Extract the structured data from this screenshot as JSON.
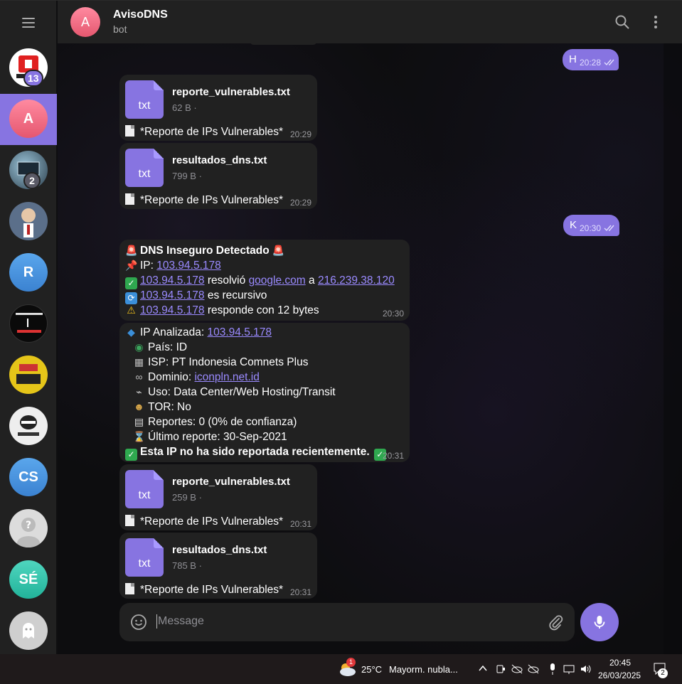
{
  "sidebar": {
    "items": [
      {
        "initials": "",
        "badge": "13",
        "color": "#ffffff"
      },
      {
        "initials": "A",
        "badge": "",
        "color": "#8774e1",
        "active": true
      },
      {
        "initials": "",
        "badge": "2",
        "color": "#4a6a7a"
      },
      {
        "initials": "",
        "badge": "",
        "color": "#5b6f8a"
      },
      {
        "initials": "R",
        "badge": "",
        "color": "#4a90d9"
      },
      {
        "initials": "",
        "badge": "",
        "color": "#111111"
      },
      {
        "initials": "",
        "badge": "",
        "color": "#e2c21d"
      },
      {
        "initials": "",
        "badge": "",
        "color": "#e8e8e8"
      },
      {
        "initials": "CS",
        "badge": "",
        "color": "#3b88d6"
      },
      {
        "initials": "",
        "badge": "",
        "color": "#d9d9d9"
      },
      {
        "initials": "SÉ",
        "badge": "",
        "color": "#2fbfa6"
      },
      {
        "initials": "",
        "badge": "",
        "color": "#c9c9c9"
      }
    ]
  },
  "header": {
    "avatar_initial": "A",
    "title": "AvisoDNS",
    "subtitle": "bot"
  },
  "messages": {
    "out1": {
      "text": "H",
      "time": "20:28"
    },
    "file1": {
      "icon_label": "txt",
      "name": "reporte_vulnerables.txt",
      "size": "62 B ·",
      "caption": "*Reporte de IPs Vulnerables*",
      "time": "20:29"
    },
    "file2": {
      "icon_label": "txt",
      "name": "resultados_dns.txt",
      "size": "799 B ·",
      "caption": "*Reporte de IPs Vulnerables*",
      "time": "20:29"
    },
    "out2": {
      "text": "K",
      "time": "20:30"
    },
    "dns": {
      "title": "DNS Inseguro Detectado",
      "ip_label": "IP:",
      "ip": "103.94.5.178",
      "resolved_word": "resolvió",
      "domain": "google.com",
      "a_word": "a",
      "resolved_ip": "216.239.38.120",
      "recursive_text": "es recursivo",
      "responds_text": "responde con 12 bytes",
      "time": "20:30"
    },
    "ipinfo": {
      "analyzed_label": "IP Analizada:",
      "ip": "103.94.5.178",
      "pais": "País: ID",
      "isp": "ISP: PT Indonesia Comnets Plus",
      "dominio_label": "Dominio:",
      "dominio": "iconpln.net.id",
      "uso": "Uso: Data Center/Web Hosting/Transit",
      "tor": "TOR: No",
      "reportes": "Reportes: 0 (0% de confianza)",
      "ultimo": "Último reporte: 30-Sep-2021",
      "status": "Esta IP no ha sido reportada recientemente.",
      "time": "20:31"
    },
    "file3": {
      "icon_label": "txt",
      "name": "reporte_vulnerables.txt",
      "size": "259 B ·",
      "caption": "*Reporte de IPs Vulnerables*",
      "time": "20:31"
    },
    "file4": {
      "icon_label": "txt",
      "name": "resultados_dns.txt",
      "size": "785 B ·",
      "caption": "*Reporte de IPs Vulnerables*",
      "time": "20:31"
    }
  },
  "input": {
    "placeholder": "Message"
  },
  "taskbar": {
    "weather_badge": "1",
    "temperature": "25°C",
    "weather_text": "Mayorm. nubla...",
    "clock_time": "20:45",
    "clock_date": "26/03/2025",
    "notification_count": "2"
  },
  "colors": {
    "accent": "#8774e1",
    "bubble": "#212121",
    "link": "#9a8aff"
  }
}
